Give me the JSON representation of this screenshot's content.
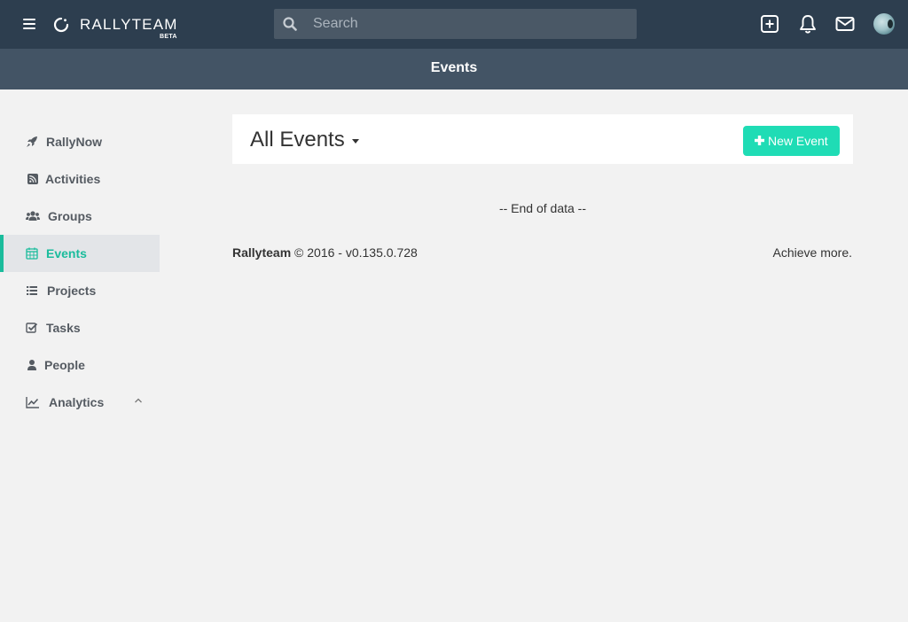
{
  "header": {
    "logo_text": "RALLYTEAM",
    "logo_badge": "BETA",
    "search": {
      "placeholder": "Search",
      "value": ""
    },
    "icons": [
      "menu-icon",
      "add-square-icon",
      "bell-icon",
      "envelope-icon",
      "avatar"
    ]
  },
  "page": {
    "title": "Events"
  },
  "sidebar": {
    "items": [
      {
        "label": "RallyNow",
        "icon": "rocket-icon"
      },
      {
        "label": "Activities",
        "icon": "rss-icon"
      },
      {
        "label": "Groups",
        "icon": "users-icon"
      },
      {
        "label": "Events",
        "icon": "calendar-icon",
        "active": true
      },
      {
        "label": "Projects",
        "icon": "list-icon"
      },
      {
        "label": "Tasks",
        "icon": "checkbox-icon"
      },
      {
        "label": "People",
        "icon": "user-icon"
      },
      {
        "label": "Analytics",
        "icon": "line-chart-icon",
        "expandable": true
      }
    ]
  },
  "main": {
    "heading": "All Events",
    "new_button_label": "New Event",
    "end_of_data": "-- End of data --"
  },
  "footer": {
    "brand": "Rallyteam",
    "copyright": "© 2016 - v0.135.0.728",
    "tagline": "Achieve more."
  },
  "colors": {
    "topbar": "#2d3e4f",
    "titlebar": "#435465",
    "accent": "#1abc9c",
    "button": "#1fdcb5",
    "background": "#f2f2f2"
  }
}
